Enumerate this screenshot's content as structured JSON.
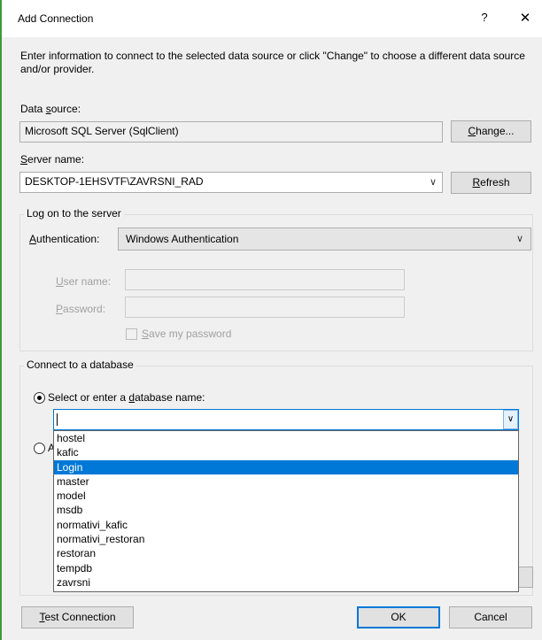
{
  "window": {
    "title": "Add Connection",
    "help_glyph": "?",
    "close_glyph": "✕"
  },
  "intro_text": "Enter information to connect to the selected data source or click \"Change\" to choose a different data source and/or provider.",
  "data_source": {
    "label_pre": "Data ",
    "label_u": "s",
    "label_post": "ource:",
    "value": "Microsoft SQL Server (SqlClient)",
    "change_pre": "",
    "change_u": "C",
    "change_post": "hange..."
  },
  "server": {
    "label_pre": "",
    "label_u": "S",
    "label_post": "erver name:",
    "value": "DESKTOP-1EHSVTF\\ZAVRSNI_RAD",
    "refresh_pre": "",
    "refresh_u": "R",
    "refresh_post": "efresh",
    "dropdown_glyph": "∨"
  },
  "logon": {
    "group_title": "Log on to the server",
    "auth_label_pre": "",
    "auth_label_u": "A",
    "auth_label_post": "uthentication:",
    "auth_value": "Windows Authentication",
    "auth_glyph": "∨",
    "user_label_pre": "",
    "user_label_u": "U",
    "user_label_post": "ser name:",
    "pass_label_pre": "",
    "pass_label_u": "P",
    "pass_label_post": "assword:",
    "save_pre": "",
    "save_u": "S",
    "save_post": "ave my password"
  },
  "database": {
    "group_title": "Connect to a database",
    "select_label_pre": "Select or enter a ",
    "select_label_u": "d",
    "select_label_post": "atabase name:",
    "attach_partial": "A",
    "input_value": "",
    "dropdown_glyph": "∨",
    "options": [
      "hostel",
      "kafic",
      "Login",
      "master",
      "model",
      "msdb",
      "normativi_kafic",
      "normativi_restoran",
      "restoran",
      "tempdb",
      "zavrsni"
    ],
    "highlighted": "Login"
  },
  "footer": {
    "test_pre": "",
    "test_u": "T",
    "test_post": "est Connection",
    "ok": "OK",
    "cancel": "Cancel"
  }
}
